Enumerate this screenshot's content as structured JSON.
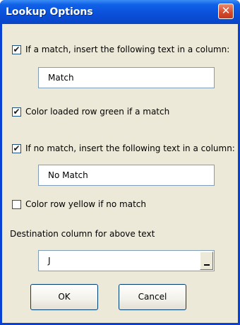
{
  "window": {
    "title": "Lookup Options",
    "close_glyph": "✕"
  },
  "options": {
    "match_insert": {
      "label": "If a match, insert the following text in a column:",
      "checked": true,
      "value": "Match"
    },
    "color_green": {
      "label": "Color loaded row green if a match",
      "checked": true
    },
    "nomatch_insert": {
      "label": "If no match, insert the following text in a column:",
      "checked": true,
      "value": "No Match"
    },
    "color_yellow": {
      "label": "Color row yellow if no match",
      "checked": false
    }
  },
  "destination": {
    "label": "Destination column for above text",
    "value": "J"
  },
  "buttons": {
    "ok": "OK",
    "cancel": "Cancel"
  },
  "check_glyph": "✔"
}
